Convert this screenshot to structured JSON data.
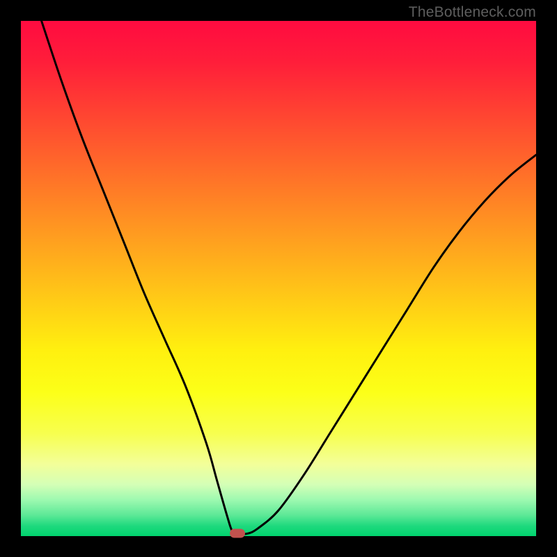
{
  "watermark": "TheBottleneck.com",
  "colors": {
    "frame": "#000000",
    "curve": "#000000",
    "marker": "#c1524e",
    "gradient_top": "#ff0b40",
    "gradient_bottom": "#00d46e"
  },
  "chart_data": {
    "type": "line",
    "title": "",
    "xlabel": "",
    "ylabel": "",
    "xlim": [
      0,
      100
    ],
    "ylim": [
      0,
      100
    ],
    "grid": false,
    "legend": false,
    "annotations": [
      "TheBottleneck.com"
    ],
    "series": [
      {
        "name": "bottleneck-curve",
        "x": [
          4,
          8,
          12,
          16,
          20,
          24,
          28,
          32,
          36,
          38,
          40,
          41,
          42,
          44,
          46,
          50,
          55,
          60,
          65,
          70,
          75,
          80,
          85,
          90,
          95,
          100
        ],
        "y": [
          100,
          88,
          77,
          67,
          57,
          47,
          38,
          29,
          18,
          11,
          4,
          1,
          0.5,
          0.5,
          1.5,
          5,
          12,
          20,
          28,
          36,
          44,
          52,
          59,
          65,
          70,
          74
        ]
      }
    ],
    "marker": {
      "x": 42,
      "y": 0.5
    },
    "background": {
      "type": "vertical-gradient",
      "meaning": "red=high bottleneck, green=low bottleneck",
      "stops": [
        {
          "pos": 0.0,
          "color": "#ff0b40"
        },
        {
          "pos": 0.5,
          "color": "#ffd215"
        },
        {
          "pos": 0.8,
          "color": "#f7ff4e"
        },
        {
          "pos": 1.0,
          "color": "#00d46e"
        }
      ]
    }
  }
}
